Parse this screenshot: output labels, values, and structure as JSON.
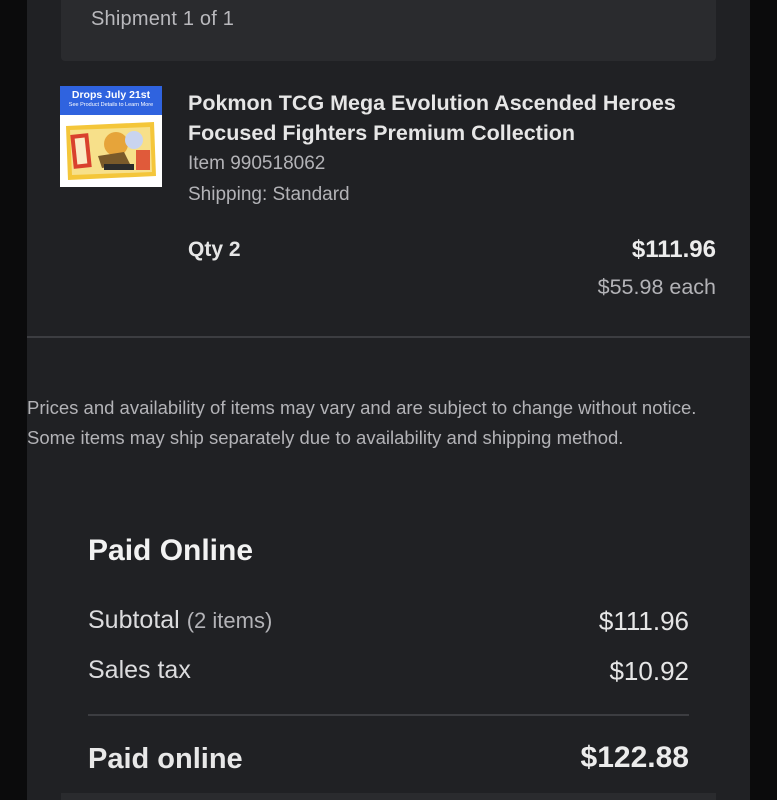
{
  "shipment": {
    "label": "Shipment 1 of 1"
  },
  "item": {
    "thumbnail": {
      "banner_title": "Drops July 21st",
      "banner_subtitle": "See Product Details to Learn More"
    },
    "title": "Pokmon TCG Mega Evolution Ascended Heroes Focused Fighters Premium Collection",
    "item_number": "Item 990518062",
    "shipping": "Shipping: Standard",
    "qty": "Qty 2",
    "line_total": "$111.96",
    "each_price": "$55.98 each"
  },
  "disclaimer": "Prices and availability of items may vary and are subject to change without notice. Some items may ship separately due to availability and shipping method.",
  "payment": {
    "heading": "Paid Online",
    "subtotal_label": "Subtotal",
    "subtotal_count": "(2 items)",
    "subtotal_value": "$111.96",
    "tax_label": "Sales tax",
    "tax_value": "$10.92",
    "total_label": "Paid online",
    "total_value": "$122.88"
  },
  "colors": {
    "background": "#202124",
    "card": "#2a2b2e",
    "banner": "#2f63df"
  }
}
